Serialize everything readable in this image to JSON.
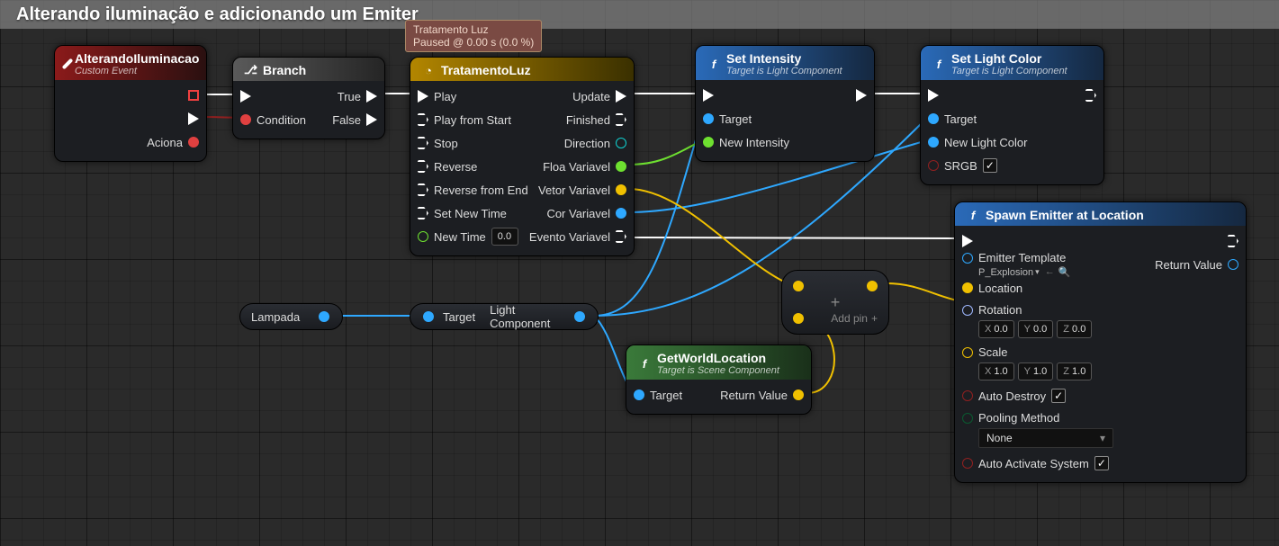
{
  "title": "Alterando iluminação e adicionando um Emiter",
  "tooltip": {
    "l1": "Tratamento Luz",
    "l2": "Paused @ 0.00 s (0.0 %)"
  },
  "nodes": {
    "custom_event": {
      "title": "AlterandoIluminacao",
      "sub": "Custom Event",
      "out": "Aciona"
    },
    "branch": {
      "title": "Branch",
      "in": "Condition",
      "outT": "True",
      "outF": "False"
    },
    "timeline": {
      "title": "TratamentoLuz",
      "ins": [
        "Play",
        "Play from Start",
        "Stop",
        "Reverse",
        "Reverse from End",
        "Set New Time"
      ],
      "newtime_lbl": "New Time",
      "newtime_val": "0.0",
      "outs": [
        "Update",
        "Finished"
      ],
      "dir": "Direction",
      "vars": [
        "Floa Variavel",
        "Vetor Variavel",
        "Cor Variavel",
        "Evento Variavel"
      ]
    },
    "set_intensity": {
      "title": "Set Intensity",
      "sub": "Target is Light Component",
      "target": "Target",
      "ni": "New Intensity"
    },
    "set_color": {
      "title": "Set Light Color",
      "sub": "Target is Light Component",
      "target": "Target",
      "nlc": "New Light Color",
      "srgb": "SRGB",
      "srgb_on": true
    },
    "lampada": "Lampada",
    "target_cast": {
      "t": "Target",
      "o": "Light Component"
    },
    "get_loc": {
      "title": "GetWorldLocation",
      "sub": "Target is Scene Component",
      "target": "Target",
      "rv": "Return Value"
    },
    "add_pin": "Add pin",
    "spawn": {
      "title": "Spawn Emitter at Location",
      "et": "Emitter Template",
      "et_val": "P_Explosion",
      "loc": "Location",
      "rot": "Rotation",
      "rot_x": "0.0",
      "rot_y": "0.0",
      "rot_z": "0.0",
      "scale": "Scale",
      "s_x": "1.0",
      "s_y": "1.0",
      "s_z": "1.0",
      "ad": "Auto Destroy",
      "ad_on": true,
      "pm": "Pooling Method",
      "pm_val": "None",
      "aas": "Auto Activate System",
      "aas_on": true,
      "rv": "Return Value"
    }
  }
}
